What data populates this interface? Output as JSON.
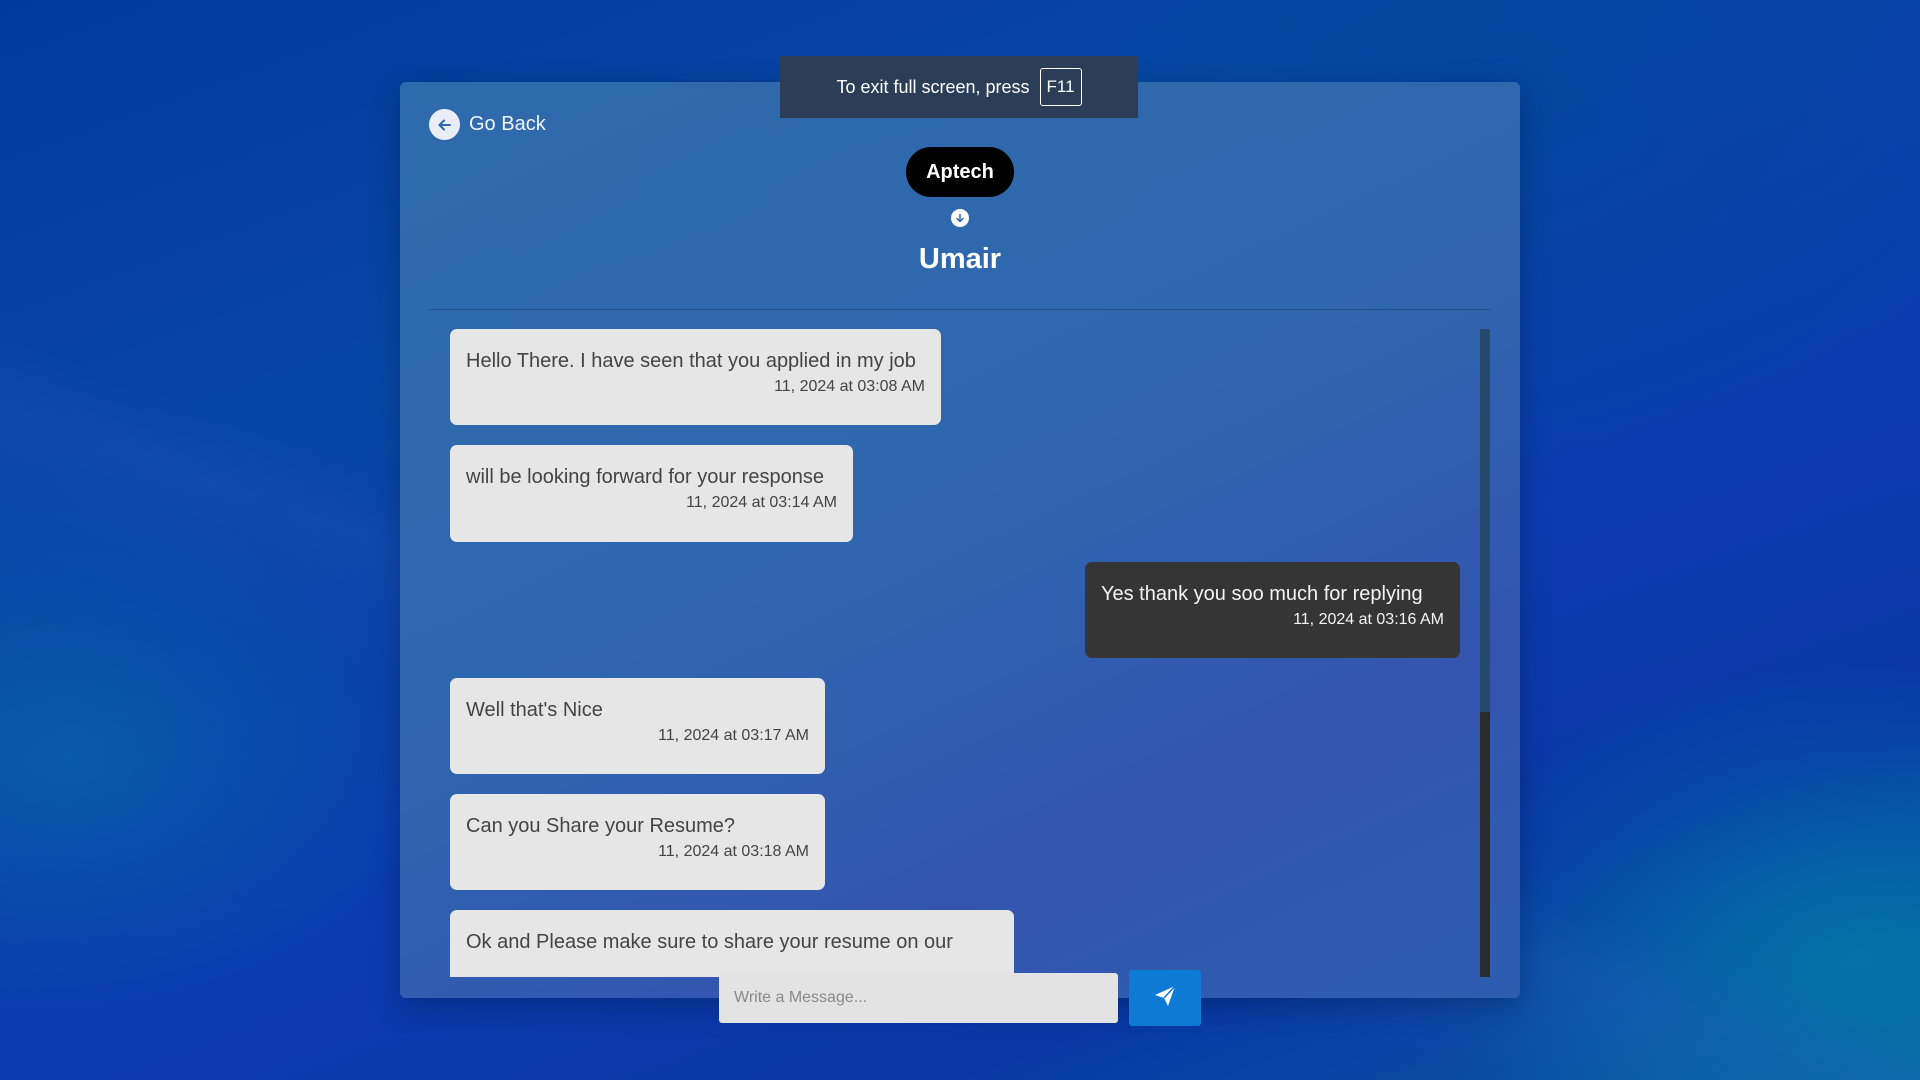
{
  "header": {
    "back_label": "Go Back",
    "company": "Aptech",
    "contact_name": "Umair"
  },
  "messages": [
    {
      "direction": "in",
      "text": "Hello There. I have seen that you applied in my job",
      "time": "11, 2024 at 03:08 AM"
    },
    {
      "direction": "in",
      "text": "will be looking forward for your response",
      "time": "11, 2024 at 03:14 AM"
    },
    {
      "direction": "out",
      "text": "Yes thank you soo much for replying",
      "time": "11, 2024 at 03:16 AM"
    },
    {
      "direction": "in",
      "text": "Well that's Nice",
      "time": "11, 2024 at 03:17 AM"
    },
    {
      "direction": "in",
      "text": "Can you Share your Resume?",
      "time": "11, 2024 at 03:18 AM"
    },
    {
      "direction": "in",
      "text": "Ok and Please make sure to share your resume on our",
      "time": ""
    }
  ],
  "composer": {
    "placeholder": "Write a Message..."
  },
  "fullscreen_notice": {
    "text": "To exit full screen, press",
    "key": "F11"
  },
  "colors": {
    "incoming_bubble": "#e6e6e6",
    "outgoing_bubble": "#353535",
    "send_button": "#0d7ad6",
    "company_pill": "#000000"
  },
  "icons": {
    "back": "arrow-left-icon",
    "scroll_down": "arrow-down-icon",
    "send": "paper-plane-icon"
  }
}
